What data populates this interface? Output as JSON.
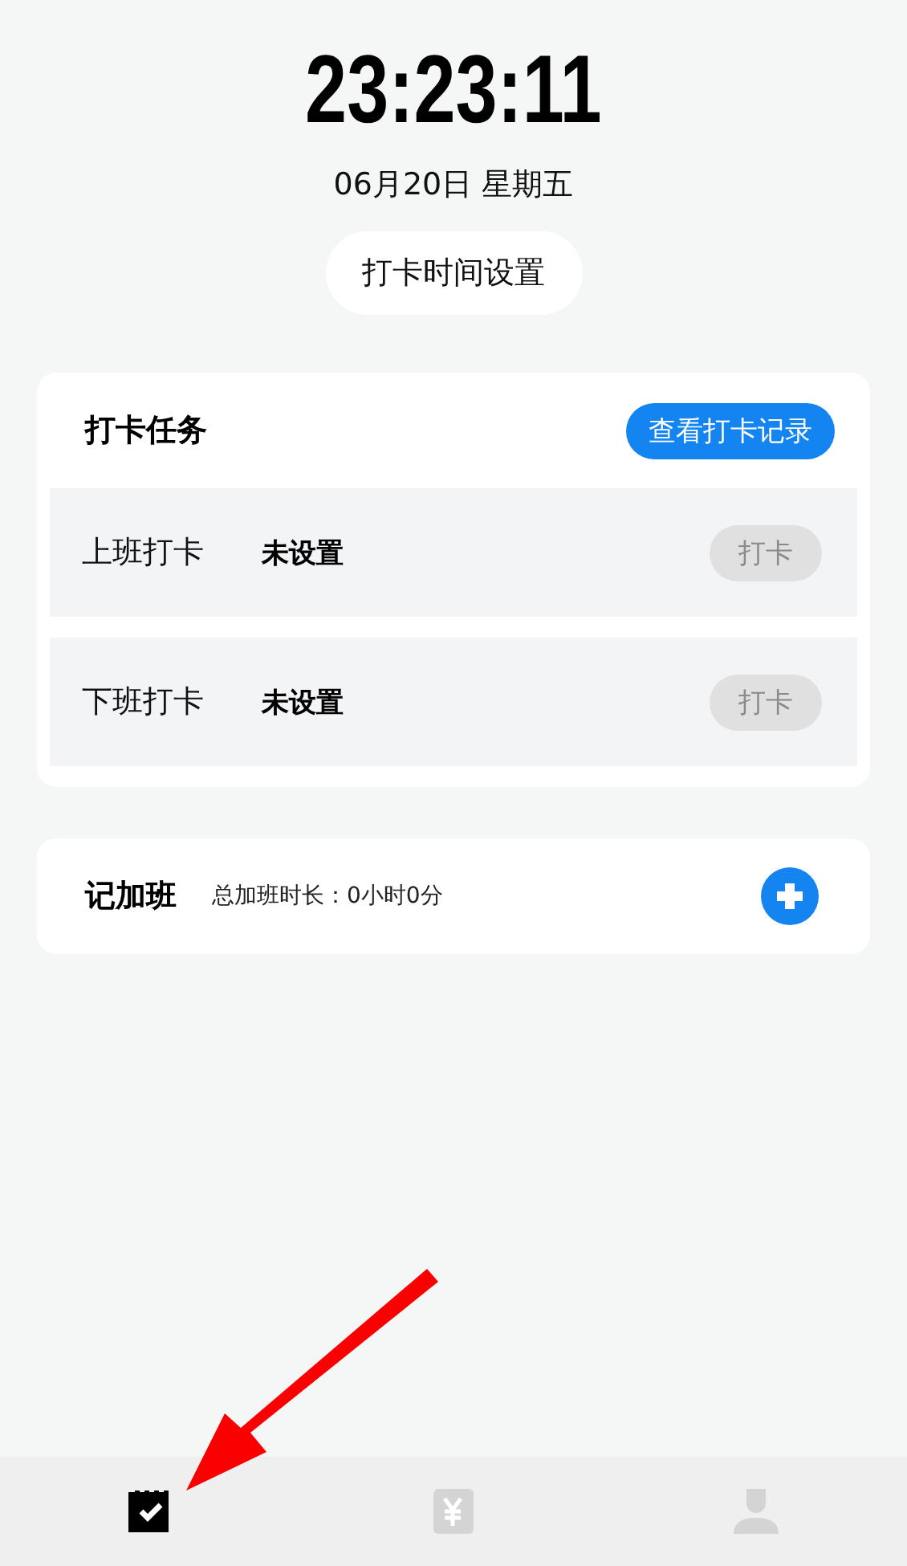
{
  "clock": {
    "time": "23:23:11",
    "date": "06月20日 星期五"
  },
  "time_settings_button": "打卡时间设置",
  "punch_card": {
    "title": "打卡任务",
    "records_button": "查看打卡记录",
    "rows": [
      {
        "label": "上班打卡",
        "value": "未设置",
        "button": "打卡",
        "disabled": true
      },
      {
        "label": "下班打卡",
        "value": "未设置",
        "button": "打卡",
        "disabled": true
      }
    ]
  },
  "overtime_card": {
    "title": "记加班",
    "summary": "总加班时长：0小时0分"
  },
  "tab_bar": [
    {
      "kind": "calendar",
      "selected": true
    },
    {
      "kind": "ledger",
      "selected": false
    },
    {
      "kind": "profile",
      "selected": false
    }
  ]
}
